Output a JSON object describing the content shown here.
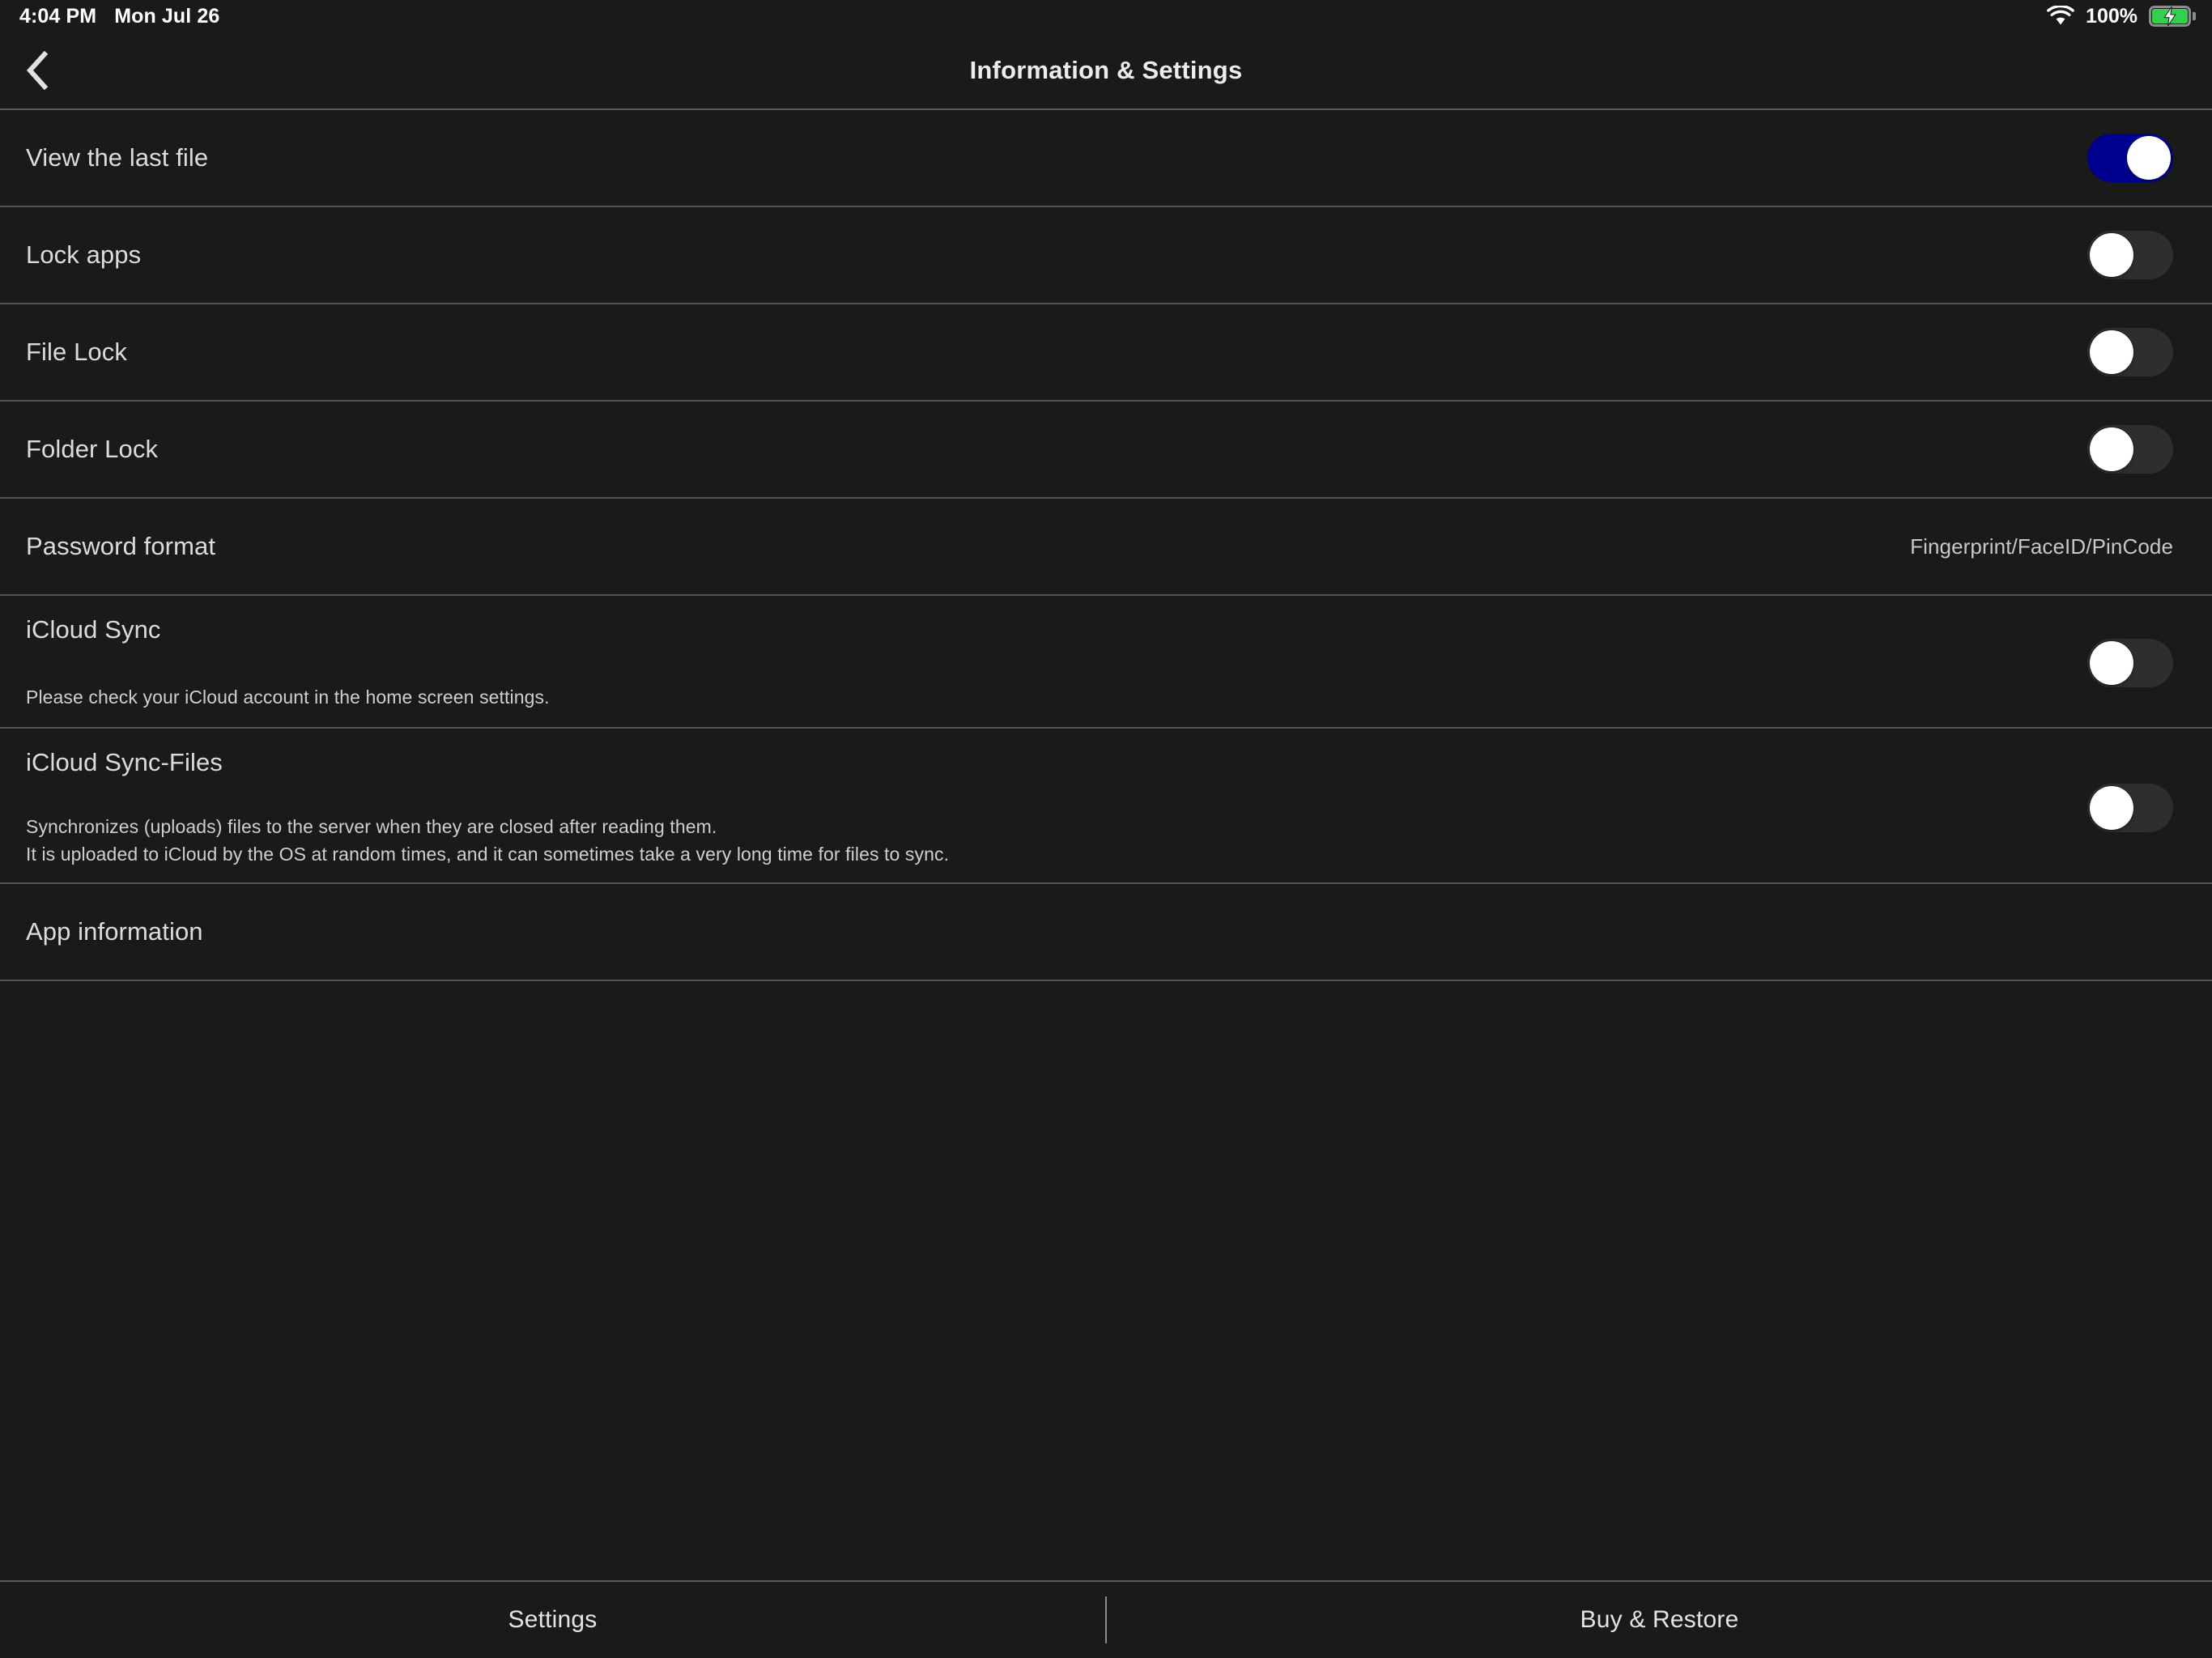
{
  "status_bar": {
    "time": "4:04 PM",
    "date": "Mon Jul 26",
    "battery_percent": "100%",
    "wifi_icon": "wifi-icon",
    "battery_icon": "battery-charging-icon",
    "battery_color": "#32d04e"
  },
  "header": {
    "back_icon": "chevron-left-icon",
    "title": "Information & Settings"
  },
  "colors": {
    "background": "#1a1a1a",
    "separator": "#555555",
    "toggle_on": "#000090",
    "toggle_off_track": "#2e2e2e",
    "knob": "#ffffff",
    "primary_text": "#dcdcdc",
    "secondary_text": "#c8c8c8"
  },
  "settings_rows": [
    {
      "id": "view-the-last-file",
      "title": "View the last file",
      "type": "toggle",
      "toggle_state": "on",
      "subtitles": []
    },
    {
      "id": "lock-apps",
      "title": "Lock apps",
      "type": "toggle",
      "toggle_state": "off",
      "subtitles": []
    },
    {
      "id": "file-lock",
      "title": "File Lock",
      "type": "toggle",
      "toggle_state": "off",
      "subtitles": []
    },
    {
      "id": "folder-lock",
      "title": "Folder Lock",
      "type": "toggle",
      "toggle_state": "off",
      "subtitles": []
    },
    {
      "id": "password-format",
      "title": "Password format",
      "type": "value",
      "value": "Fingerprint/FaceID/PinCode",
      "subtitles": []
    },
    {
      "id": "icloud-sync",
      "title": "iCloud Sync",
      "type": "toggle",
      "toggle_state": "off",
      "subtitles": [
        "Please check your iCloud account in the home screen settings."
      ]
    },
    {
      "id": "icloud-sync-files",
      "title": "iCloud Sync-Files",
      "type": "toggle",
      "toggle_state": "off",
      "subtitles": [
        "Synchronizes (uploads) files to the server when they are closed after reading them.",
        "It is uploaded to iCloud by the OS at random times, and it can sometimes take a very long time for files to sync."
      ]
    },
    {
      "id": "app-information",
      "title": "App information",
      "type": "plain",
      "subtitles": []
    }
  ],
  "bottom_bar": {
    "tabs": [
      {
        "id": "settings",
        "label": "Settings"
      },
      {
        "id": "buy-restore",
        "label": "Buy & Restore"
      }
    ]
  }
}
